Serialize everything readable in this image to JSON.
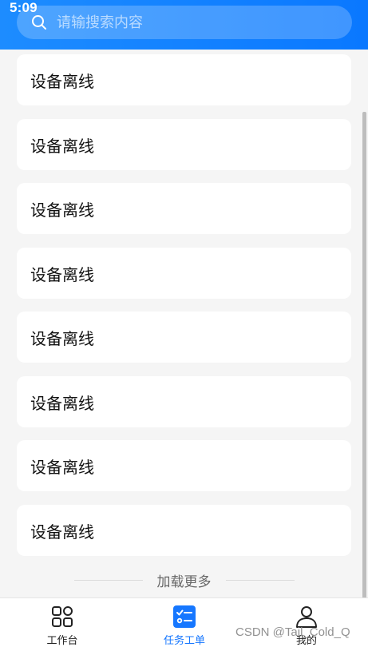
{
  "status_bar": {
    "time": "5:09"
  },
  "search": {
    "placeholder": "请输搜索内容",
    "value": ""
  },
  "list": {
    "items": [
      {
        "label": "设备离线"
      },
      {
        "label": "设备离线"
      },
      {
        "label": "设备离线"
      },
      {
        "label": "设备离线"
      },
      {
        "label": "设备离线"
      },
      {
        "label": "设备离线"
      },
      {
        "label": "设备离线"
      },
      {
        "label": "设备离线"
      }
    ]
  },
  "load_more": {
    "label": "加载更多"
  },
  "bottom_nav": {
    "items": [
      {
        "label": "工作台",
        "icon": "grid-icon",
        "active": false
      },
      {
        "label": "任务工单",
        "icon": "task-list-icon",
        "active": true
      },
      {
        "label": "我的",
        "icon": "user-icon",
        "active": false
      }
    ],
    "active_color": "#1677ff"
  },
  "watermark": {
    "text": "CSDN @Tail_Cold_Q"
  },
  "colors": {
    "header": "#0a78ff",
    "background": "#f5f5f5"
  }
}
